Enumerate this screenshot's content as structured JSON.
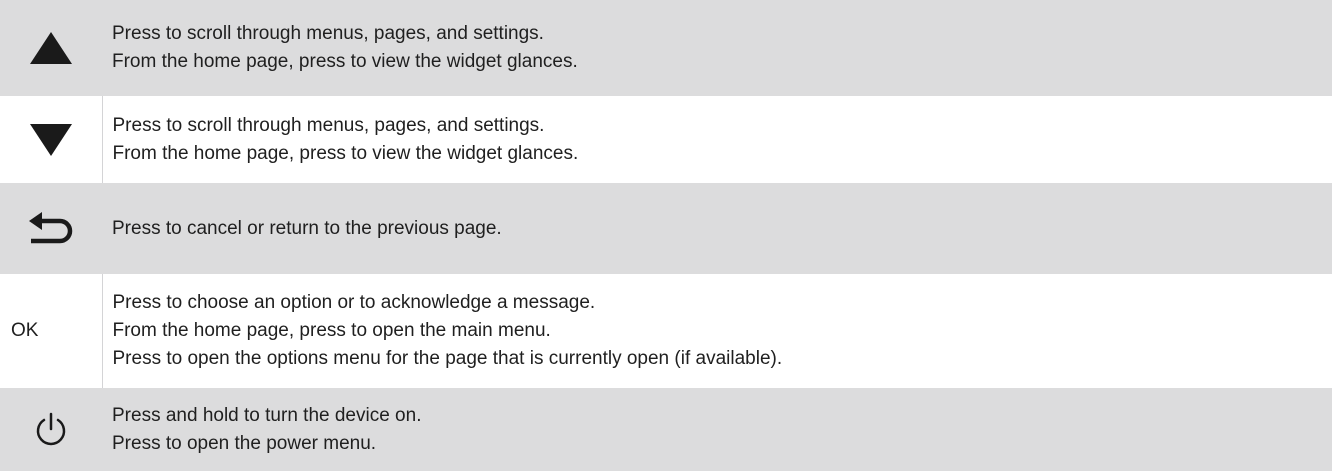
{
  "rows": [
    {
      "key_icon": "up-triangle-icon",
      "lines": [
        "Press to scroll through menus, pages, and settings.",
        "From the home page, press to view the widget glances."
      ]
    },
    {
      "key_icon": "down-triangle-icon",
      "lines": [
        "Press to scroll through menus, pages, and settings.",
        "From the home page, press to view the widget glances."
      ]
    },
    {
      "key_icon": "back-arrow-icon",
      "lines": [
        "Press to cancel or return to the previous page."
      ]
    },
    {
      "key_label": "OK",
      "lines": [
        "Press to choose an option or to acknowledge a message.",
        "From the home page, press to open the main menu.",
        "Press to open the options menu for the page that is currently open (if available)."
      ]
    },
    {
      "key_icon": "power-icon",
      "lines": [
        "Press and hold to turn the device on.",
        "Press to open the power menu."
      ]
    }
  ],
  "colors": {
    "shaded_row": "#dcdcdd",
    "plain_row": "#ffffff",
    "icon": "#1a1a1a",
    "text": "#1f1f1f"
  }
}
